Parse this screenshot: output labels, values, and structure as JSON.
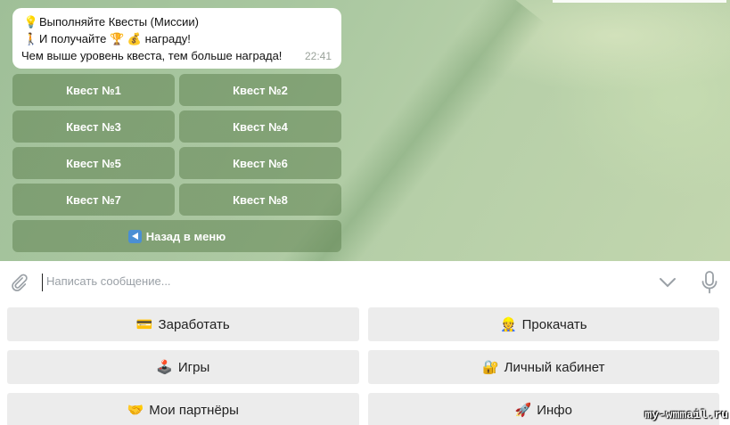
{
  "message": {
    "line1_icon": "💡",
    "line1": "Выполняйте Квесты (Миссии)",
    "line2_icon": "🚶",
    "line2_pre": "И получайте",
    "line2_trophy": "🏆",
    "line2_money": "💰",
    "line2_post": "награду!",
    "line3": "Чем выше уровень квеста, тем больше награда!",
    "time": "22:41"
  },
  "inline_keyboard": {
    "quests": [
      "Квест №1",
      "Квест №2",
      "Квест №3",
      "Квест №4",
      "Квест №5",
      "Квест №6",
      "Квест №7",
      "Квест №8"
    ],
    "back_label": "Назад в меню",
    "back_icon": "arrow-left-box-icon"
  },
  "input": {
    "placeholder": "Написать сообщение..."
  },
  "reply_keyboard": [
    {
      "emoji": "💳",
      "label": "Заработать"
    },
    {
      "emoji": "👷",
      "label": "Прокачать"
    },
    {
      "emoji": "🕹️",
      "label": "Игры"
    },
    {
      "emoji": "🔐",
      "label": "Личный кабинет"
    },
    {
      "emoji": "🤝",
      "label": "Мои партнёры"
    },
    {
      "emoji": "🚀",
      "label": "Инфо"
    }
  ],
  "watermark": "my-wmmail.ru"
}
